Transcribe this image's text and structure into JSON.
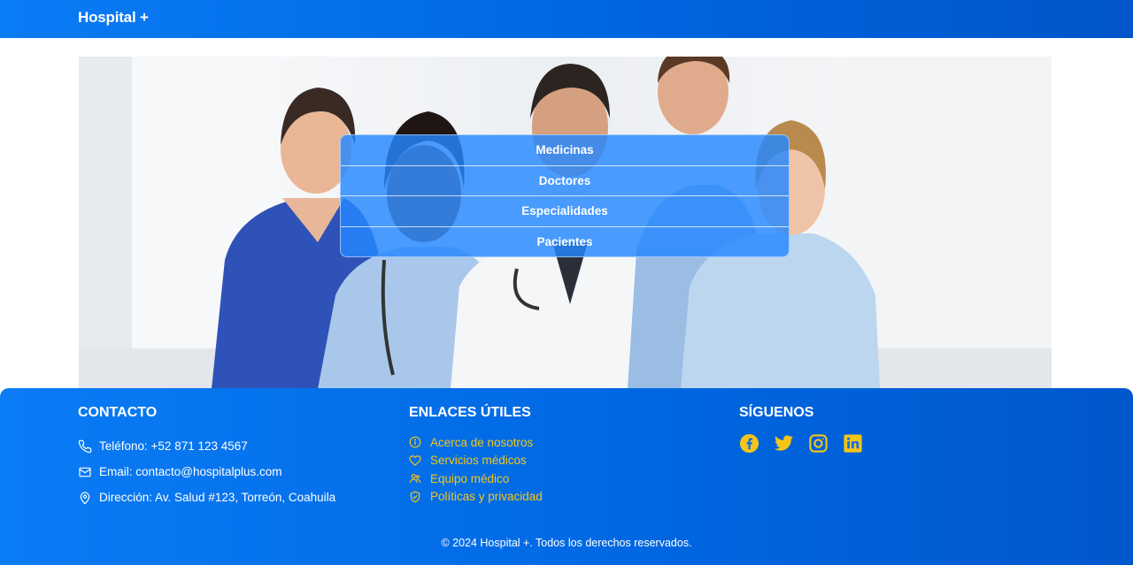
{
  "header": {
    "brand": "Hospital +"
  },
  "menu": {
    "items": [
      {
        "label": "Medicinas"
      },
      {
        "label": "Doctores"
      },
      {
        "label": "Especialidades"
      },
      {
        "label": "Pacientes"
      }
    ]
  },
  "footer": {
    "contact": {
      "title": "CONTACTO",
      "lines": [
        {
          "icon": "phone-icon",
          "text": "Teléfono: +52 871 123 4567"
        },
        {
          "icon": "mail-icon",
          "text": "Email: contacto@hospitalplus.com"
        },
        {
          "icon": "location-pin-icon",
          "text": "Dirección: Av. Salud #123, Torreón, Coahuila"
        }
      ]
    },
    "links": {
      "title": "ENLACES ÚTILES",
      "items": [
        {
          "icon": "info-icon",
          "label": "Acerca de nosotros"
        },
        {
          "icon": "heart-icon",
          "label": "Servicios médicos"
        },
        {
          "icon": "team-icon",
          "label": "Equipo médico"
        },
        {
          "icon": "shield-icon",
          "label": "Políticas y privacidad"
        }
      ]
    },
    "social": {
      "title": "SÍGUENOS",
      "icons": [
        "facebook-icon",
        "twitter-icon",
        "instagram-icon",
        "linkedin-icon"
      ]
    },
    "copyright": "© 2024 Hospital +. Todos los derechos reservados."
  },
  "colors": {
    "primary": "#0a7cf5",
    "primary_dark": "#0057cc",
    "link_yellow": "#f5c518",
    "menu_overlay": "#2587ff"
  }
}
